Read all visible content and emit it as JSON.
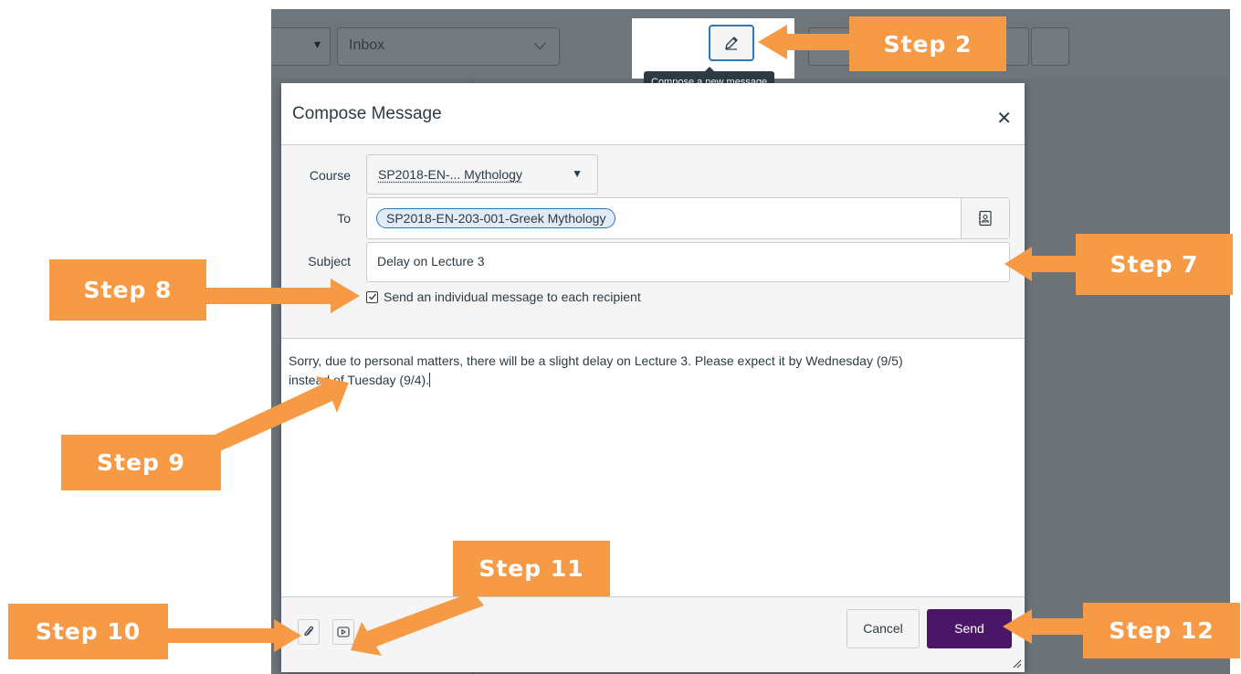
{
  "background": {
    "mailbox_dropdown_label": "Inbox",
    "compose_tooltip": "Compose a new message"
  },
  "modal": {
    "title": "Compose Message",
    "close_icon": "close-icon",
    "course_label": "Course",
    "course_value": "SP2018-EN-... Mythology",
    "to_label": "To",
    "to_recipient": "SP2018-EN-203-001-Greek Mythology",
    "subject_label": "Subject",
    "subject_value": "Delay on Lecture 3",
    "individual_message_label": "Send an individual message to each recipient",
    "individual_message_checked": true,
    "body_line1": "Sorry, due to personal matters, there will be a slight delay on Lecture 3. Please expect it by Wednesday (9/5)",
    "body_line2": "instead of Tuesday (9/4).",
    "cancel_label": "Cancel",
    "send_label": "Send"
  },
  "callouts": {
    "step2": "Step 2",
    "step7": "Step 7",
    "step8": "Step 8",
    "step9": "Step 9",
    "step10": "Step 10",
    "step11": "Step 11",
    "step12": "Step 12"
  },
  "colors": {
    "callout": "#f79a46",
    "send_button": "#4a1768",
    "focus_blue": "#2b7abc"
  }
}
